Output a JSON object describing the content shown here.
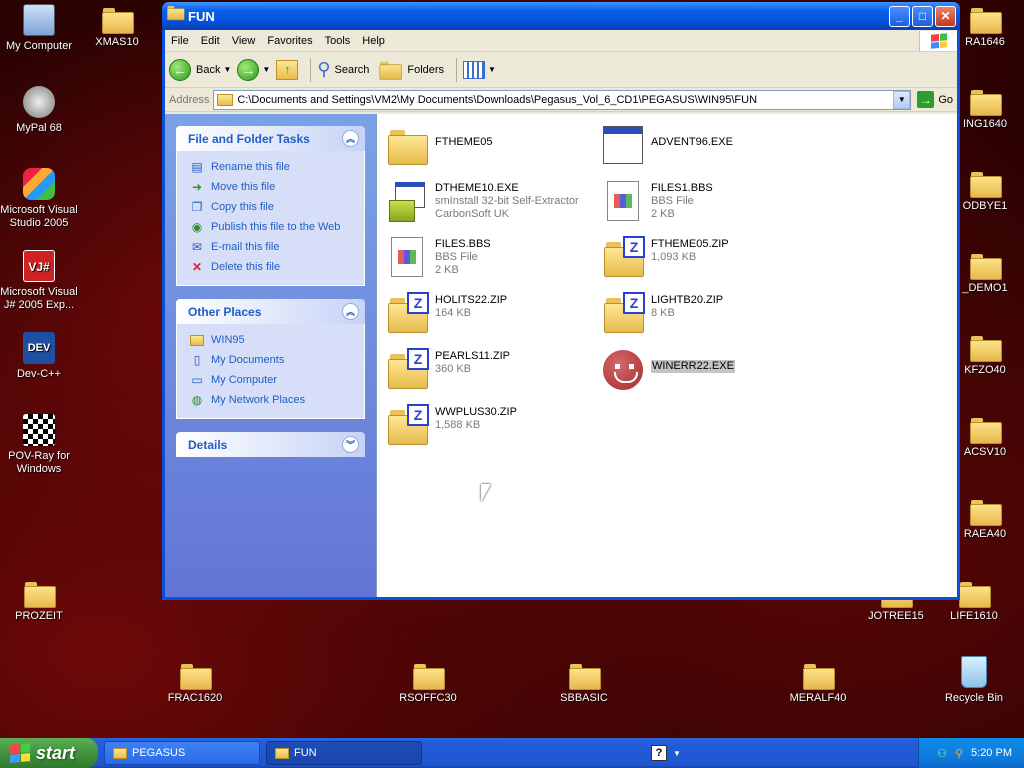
{
  "desktop": {
    "icons": [
      {
        "label": "My Computer"
      },
      {
        "label": "XMAS10"
      },
      {
        "label": "MyPal 68"
      },
      {
        "label": "Microsoft Visual Studio 2005"
      },
      {
        "label": "Microsoft Visual J# 2005 Exp..."
      },
      {
        "label": "Dev-C++"
      },
      {
        "label": "POV-Ray for Windows"
      },
      {
        "label": "PROZEIT"
      },
      {
        "label": "FRAC1620"
      },
      {
        "label": "RSOFFC30"
      },
      {
        "label": "SBBASIC"
      },
      {
        "label": "MERALF40"
      },
      {
        "label": "Recycle Bin"
      },
      {
        "label": "JOTREE15"
      },
      {
        "label": "LIFE1610"
      },
      {
        "label": "RA1646"
      },
      {
        "label": "ING1640"
      },
      {
        "label": "ODBYE1"
      },
      {
        "label": "_DEMO1"
      },
      {
        "label": "KFZO40"
      },
      {
        "label": "ACSV10"
      },
      {
        "label": "RAEA40"
      }
    ]
  },
  "window": {
    "title": "FUN",
    "menu": [
      "File",
      "Edit",
      "View",
      "Favorites",
      "Tools",
      "Help"
    ],
    "toolbar": {
      "back": "Back",
      "search": "Search",
      "folders": "Folders"
    },
    "address": {
      "label": "Address",
      "value": "C:\\Documents and Settings\\VM2\\My Documents\\Downloads\\Pegasus_Vol_6_CD1\\PEGASUS\\WIN95\\FUN",
      "go": "Go"
    },
    "tasks": {
      "file_folder": {
        "title": "File and Folder Tasks",
        "items": [
          "Rename this file",
          "Move this file",
          "Copy this file",
          "Publish this file to the Web",
          "E-mail this file",
          "Delete this file"
        ]
      },
      "other_places": {
        "title": "Other Places",
        "items": [
          "WIN95",
          "My Documents",
          "My Computer",
          "My Network Places"
        ]
      },
      "details": {
        "title": "Details"
      }
    },
    "files": [
      {
        "name": "FTHEME05",
        "line2": "",
        "line3": ""
      },
      {
        "name": "ADVENT96.EXE",
        "line2": "",
        "line3": ""
      },
      {
        "name": "DTHEME10.EXE",
        "line2": "smInstall 32-bit Self-Extractor",
        "line3": "CarbonSoft UK"
      },
      {
        "name": "FILES1.BBS",
        "line2": "BBS File",
        "line3": "2 KB"
      },
      {
        "name": "FILES.BBS",
        "line2": "BBS File",
        "line3": "2 KB"
      },
      {
        "name": "FTHEME05.ZIP",
        "line2": "1,093 KB",
        "line3": ""
      },
      {
        "name": "HOLITS22.ZIP",
        "line2": "164 KB",
        "line3": ""
      },
      {
        "name": "LIGHTB20.ZIP",
        "line2": "8 KB",
        "line3": ""
      },
      {
        "name": "PEARLS11.ZIP",
        "line2": "360 KB",
        "line3": ""
      },
      {
        "name": "WINERR22.EXE",
        "line2": "",
        "line3": ""
      },
      {
        "name": "WWPLUS30.ZIP",
        "line2": "1,588 KB",
        "line3": ""
      }
    ]
  },
  "taskbar": {
    "start": "start",
    "tasks": [
      "PEGASUS",
      "FUN"
    ],
    "clock": "5:20 PM"
  }
}
